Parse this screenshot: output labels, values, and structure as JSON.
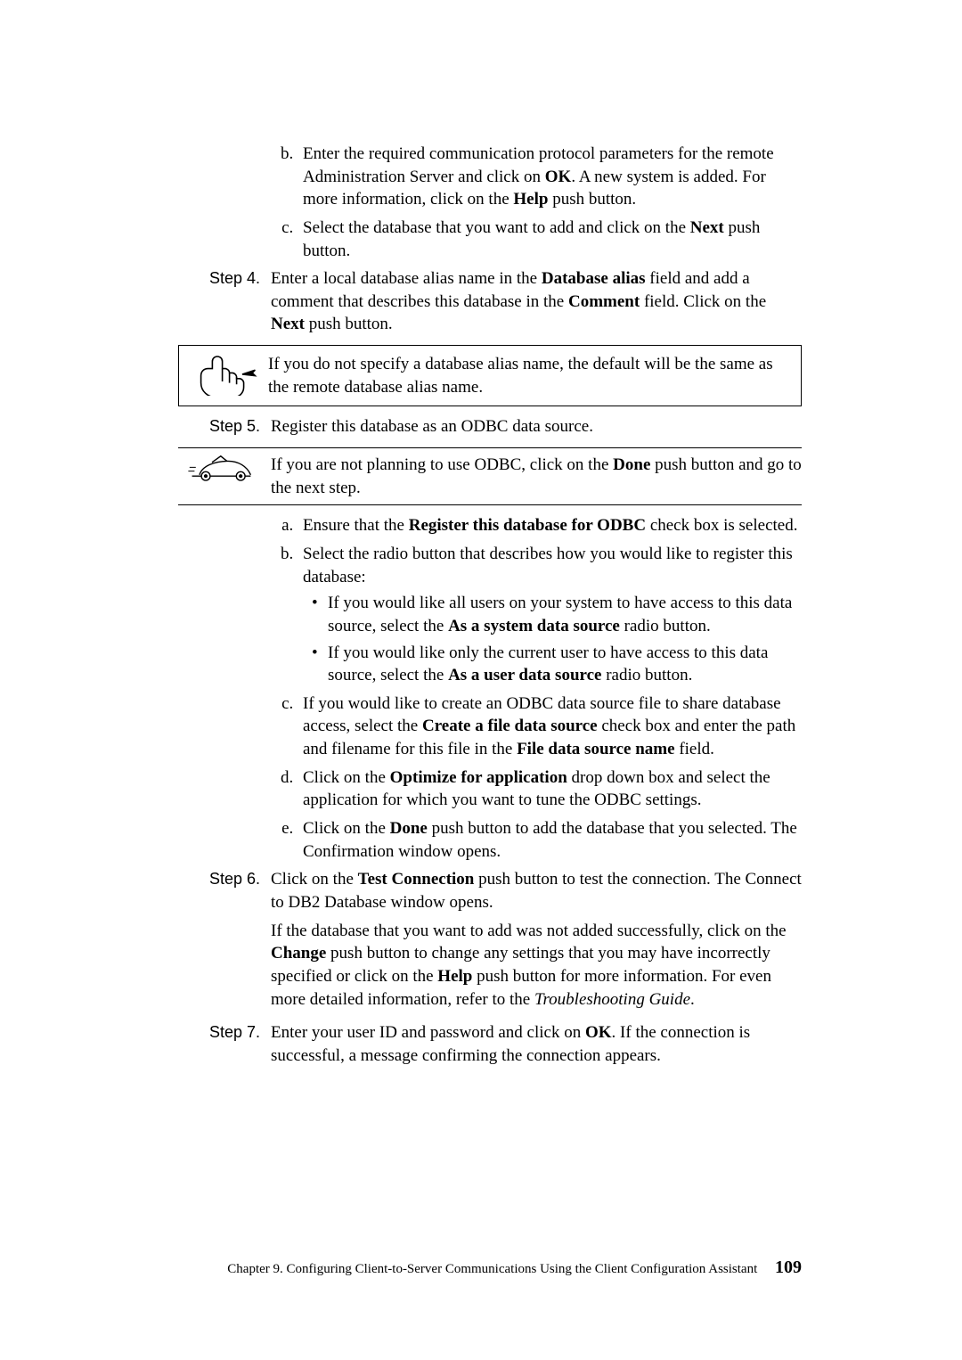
{
  "steps": {
    "sub_prev": {
      "b": {
        "parts": [
          "Enter the required communication protocol parameters for the remote Administration Server and click on ",
          "OK",
          ". A new system is added. For more information, click on the ",
          "Help",
          " push button."
        ]
      },
      "c": {
        "parts": [
          "Select the database that you want to add and click on the ",
          "Next",
          " push button."
        ]
      }
    },
    "s4": {
      "label": "Step 4.",
      "parts": [
        "Enter a local database alias name in the ",
        "Database alias",
        " field and add a comment that describes this database in the ",
        "Comment",
        " field. Click on the ",
        "Next",
        " push button."
      ]
    },
    "note4": "If you do not specify a database alias name, the default will be the same as the remote database alias name.",
    "s5": {
      "label": "Step 5.",
      "text": "Register this database as an ODBC data source."
    },
    "note5": {
      "parts": [
        "If you are not planning to use ODBC, click on the ",
        "Done",
        " push button and go to the next step."
      ]
    },
    "s5list": {
      "a": {
        "parts": [
          "Ensure that the ",
          "Register this database for ODBC",
          " check box is selected."
        ]
      },
      "b": {
        "lead": "Select the radio button that describes how you would like to register this database:",
        "b1": {
          "parts": [
            "If you would like all users on your system to have access to this data source, select the ",
            "As a system data source",
            " radio button."
          ]
        },
        "b2": {
          "parts": [
            "If you would like only the current user to have access to this data source, select the ",
            "As a user data source",
            " radio button."
          ]
        }
      },
      "c": {
        "parts": [
          "If you would like to create an ODBC data source file to share database access, select the ",
          "Create a file data source",
          " check box and enter the path and filename for this file in the ",
          "File data source name",
          " field."
        ]
      },
      "d": {
        "parts": [
          "Click on the ",
          "Optimize for application",
          " drop down box and select the application for which you want to tune the ODBC settings."
        ]
      },
      "e": {
        "parts": [
          "Click on the ",
          "Done",
          " push button to add the database that you selected. The Confirmation window opens."
        ]
      }
    },
    "s6": {
      "label": "Step 6.",
      "p1": {
        "parts": [
          "Click on the ",
          "Test Connection",
          " push button to test the connection. The Connect to DB2 Database window opens."
        ]
      },
      "p2": {
        "parts": [
          "If the database that you want to add was not added successfully, click on the ",
          "Change",
          " push button to change any settings that you may have incorrectly specified or click on the ",
          "Help",
          " push button for more information. For even more detailed information, refer to the "
        ],
        "italic": "Troubleshooting Guide",
        "tail": "."
      }
    },
    "s7": {
      "label": "Step 7.",
      "parts": [
        "Enter your user ID and password and click on ",
        "OK",
        ". If the connection is successful, a message confirming the connection appears."
      ]
    }
  },
  "footer": {
    "text": "Chapter 9. Configuring Client-to-Server Communications Using the Client Configuration Assistant",
    "page": "109"
  }
}
